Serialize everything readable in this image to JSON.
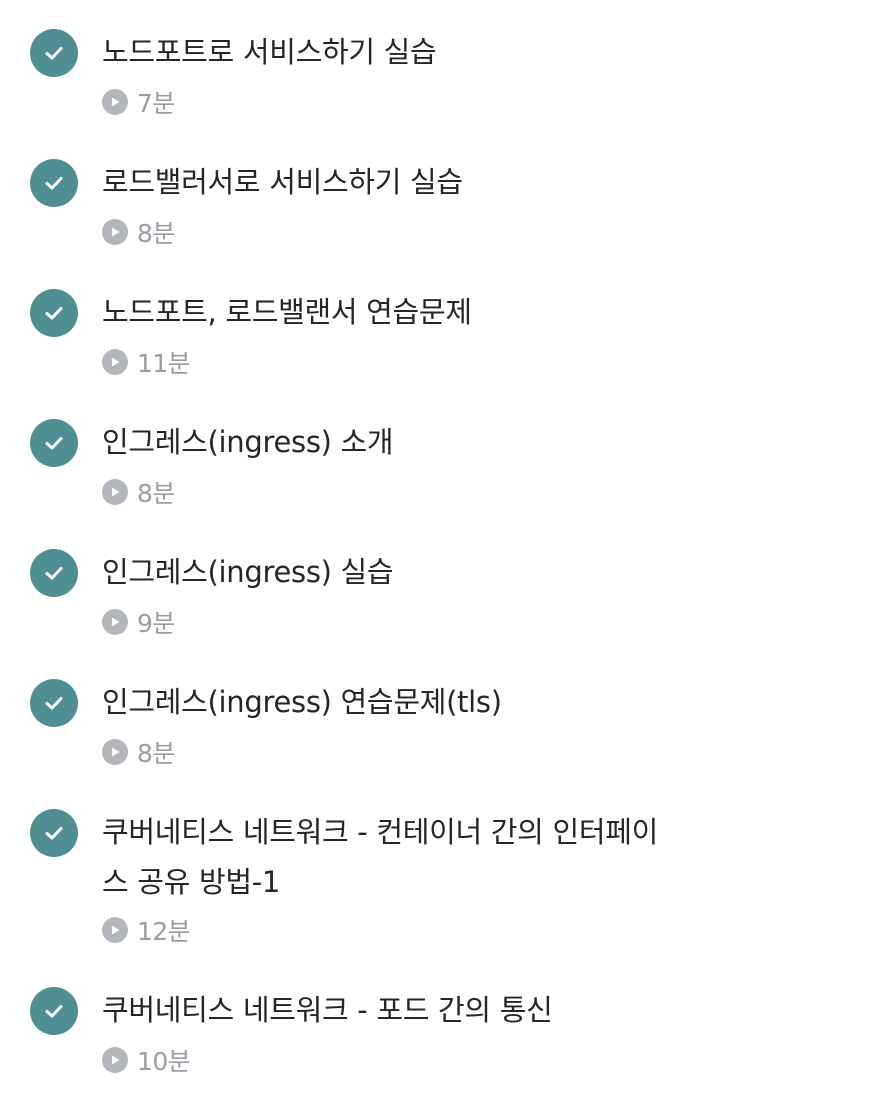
{
  "lessons": [
    {
      "title": "노드포트로 서비스하기 실습",
      "duration": "7분",
      "completed": true
    },
    {
      "title": "로드밸러서로 서비스하기 실습",
      "duration": "8분",
      "completed": true
    },
    {
      "title": "노드포트, 로드밸랜서 연습문제",
      "duration": "11분",
      "completed": true
    },
    {
      "title": "인그레스(ingress) 소개",
      "duration": "8분",
      "completed": true
    },
    {
      "title": "인그레스(ingress) 실습",
      "duration": "9분",
      "completed": true
    },
    {
      "title": "인그레스(ingress) 연습문제(tls)",
      "duration": "8분",
      "completed": true
    },
    {
      "title": "쿠버네티스 네트워크 - 컨테이너 간의 인터페이\n스 공유 방법-1",
      "duration": "12분",
      "completed": true
    },
    {
      "title": "쿠버네티스 네트워크 - 포드 간의 통신",
      "duration": "10분",
      "completed": true
    }
  ],
  "icons": {
    "completed": "check-circle-icon",
    "duration": "play-circle-icon"
  },
  "colors": {
    "check_bg": "#4f8f92",
    "title_text": "#262626",
    "duration_text": "#9a9da3",
    "play_icon": "#b3b6bb"
  }
}
